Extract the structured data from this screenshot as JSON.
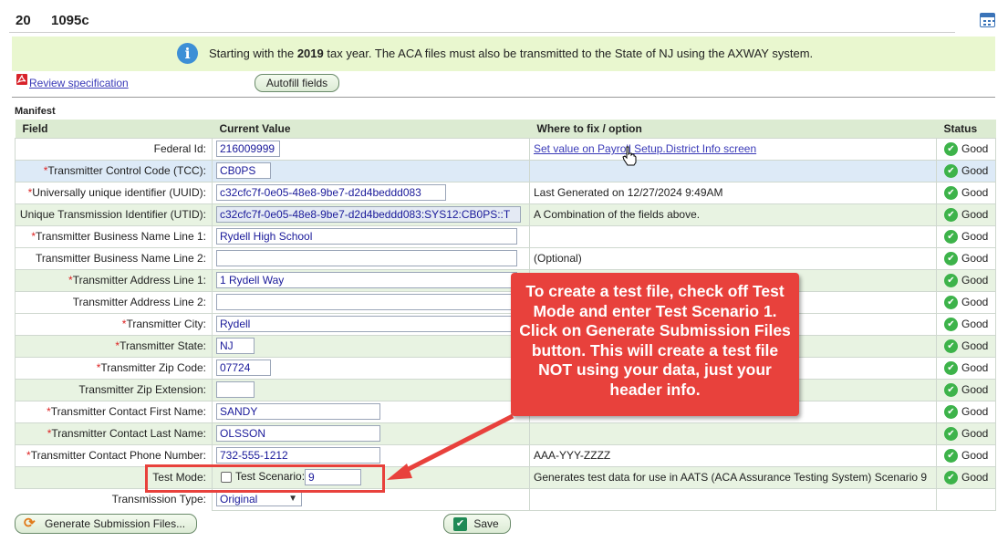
{
  "header": {
    "year": "20",
    "form": "1095c"
  },
  "banner": {
    "prefix": "Starting with the ",
    "year": "2019",
    "suffix": " tax year. The ACA files must also be transmitted to the State of NJ using the AXWAY system."
  },
  "links": {
    "review": "Review specification"
  },
  "buttons": {
    "autofill": "Autofill fields",
    "generate": "Generate Submission Files...",
    "save": "Save"
  },
  "section_title": "Manifest",
  "columns": [
    "Field",
    "Current Value",
    "Where to fix / option",
    "Status"
  ],
  "rows": [
    {
      "label": "Federal Id:",
      "required": "",
      "value": "216009999",
      "fix": "Set value on Payroll Setup.District Info screen",
      "status": "Good"
    },
    {
      "label": "Transmitter Control Code (TCC):",
      "required": "*",
      "value": "CB0PS",
      "fix": "",
      "status": "Good"
    },
    {
      "label": "Universally unique identifier (UUID):",
      "required": "*",
      "value": "c32cfc7f-0e05-48e8-9be7-d2d4beddd083",
      "fix": "Last Generated on 12/27/2024 9:49AM",
      "status": "Good"
    },
    {
      "label": "Unique Transmission Identifier (UTID):",
      "required": "",
      "value": "c32cfc7f-0e05-48e8-9be7-d2d4beddd083:SYS12:CB0PS::T",
      "fix": "A Combination of the fields above.",
      "status": "Good"
    },
    {
      "label": "Transmitter Business Name Line 1:",
      "required": "*",
      "value": "Rydell High School",
      "fix": "",
      "status": "Good"
    },
    {
      "label": "Transmitter Business Name Line 2:",
      "required": "",
      "value": "",
      "fix": "(Optional)",
      "status": "Good"
    },
    {
      "label": "Transmitter Address Line 1:",
      "required": "*",
      "value": "1 Rydell Way",
      "fix": "",
      "status": "Good"
    },
    {
      "label": "Transmitter Address Line 2:",
      "required": "",
      "value": "",
      "fix": "",
      "status": "Good"
    },
    {
      "label": "Transmitter City:",
      "required": "*",
      "value": "Rydell",
      "fix": "",
      "status": "Good"
    },
    {
      "label": "Transmitter State:",
      "required": "*",
      "value": "NJ",
      "fix": "",
      "status": "Good"
    },
    {
      "label": "Transmitter Zip Code:",
      "required": "*",
      "value": "07724",
      "fix": "",
      "status": "Good"
    },
    {
      "label": "Transmitter Zip Extension:",
      "required": "",
      "value": "",
      "fix": "",
      "status": "Good"
    },
    {
      "label": "Transmitter Contact First Name:",
      "required": "*",
      "value": "SANDY",
      "fix": "",
      "status": "Good"
    },
    {
      "label": "Transmitter Contact Last Name:",
      "required": "*",
      "value": "OLSSON",
      "fix": "",
      "status": "Good"
    },
    {
      "label": "Transmitter Contact Phone Number:",
      "required": "*",
      "value": "732-555-1212",
      "fix": "AAA-YYY-ZZZZ",
      "status": "Good"
    }
  ],
  "test_mode": {
    "label": "Test Mode:",
    "checked": false,
    "scenario_label": "Test Scenario:",
    "scenario_value": "9",
    "fix": "Generates test data for use in AATS (ACA Assurance Testing System) Scenario 9",
    "status": "Good"
  },
  "transmission_type": {
    "label": "Transmission Type:",
    "value": "Original"
  },
  "callout": "To create a test file, check off Test Mode and enter Test Scenario 1.  Click on Generate Submission Files button.  This will create a test file NOT using your data, just your header info.",
  "colors": {
    "callout": "#e8413c",
    "good": "#3db34a",
    "header_bg": "#dcebd2",
    "banner_bg": "#e9f7cf"
  }
}
